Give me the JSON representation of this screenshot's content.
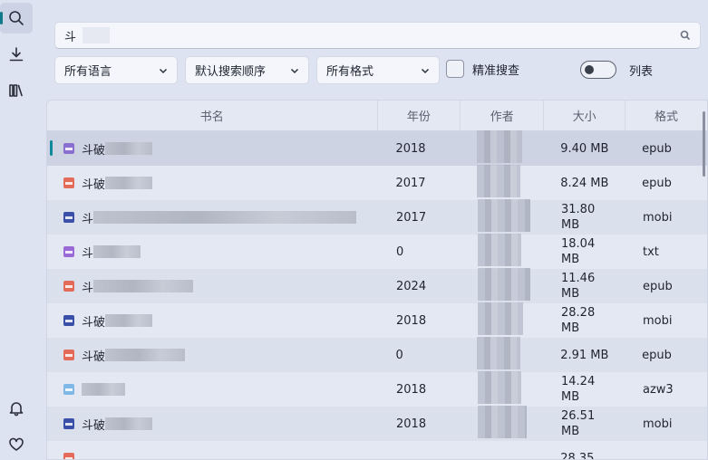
{
  "search": {
    "value": "斗"
  },
  "filters": {
    "language": "所有语言",
    "order": "默认搜索顺序",
    "format": "所有格式",
    "exact_label": "精准搜查",
    "list_label": "列表"
  },
  "table": {
    "headers": [
      "书名",
      "年份",
      "作者",
      "大小",
      "格式"
    ],
    "rows": [
      {
        "title": "斗破",
        "year": "2018",
        "size": "9.40 MB",
        "format": "epub",
        "icon_color": "#8a6fd0"
      },
      {
        "title": "斗破",
        "year": "2017",
        "size": "8.24 MB",
        "format": "epub",
        "icon_color": "#e46a5a"
      },
      {
        "title": "斗",
        "year": "2017",
        "size": "31.80 MB",
        "format": "mobi",
        "icon_color": "#3a4fa8"
      },
      {
        "title": "斗",
        "year": "0",
        "size": "18.04 MB",
        "format": "txt",
        "icon_color": "#9a6ad6"
      },
      {
        "title": "斗",
        "year": "2024",
        "size": "11.46 MB",
        "format": "epub",
        "icon_color": "#e46a5a"
      },
      {
        "title": "斗破",
        "year": "2018",
        "size": "28.28 MB",
        "format": "mobi",
        "icon_color": "#3a4fa8"
      },
      {
        "title": "斗破",
        "year": "0",
        "size": "2.91 MB",
        "format": "epub",
        "icon_color": "#e46a5a"
      },
      {
        "title": "",
        "year": "2018",
        "size": "14.24 MB",
        "format": "azw3",
        "icon_color": "#7fb8e6"
      },
      {
        "title": "斗破",
        "year": "2018",
        "size": "26.51 MB",
        "format": "mobi",
        "icon_color": "#3a4fa8"
      },
      {
        "title": "",
        "year": "",
        "size": "28.35",
        "format": "",
        "icon_color": "#e46a5a"
      }
    ]
  },
  "colors": {
    "accent": "#0f8a9c"
  }
}
